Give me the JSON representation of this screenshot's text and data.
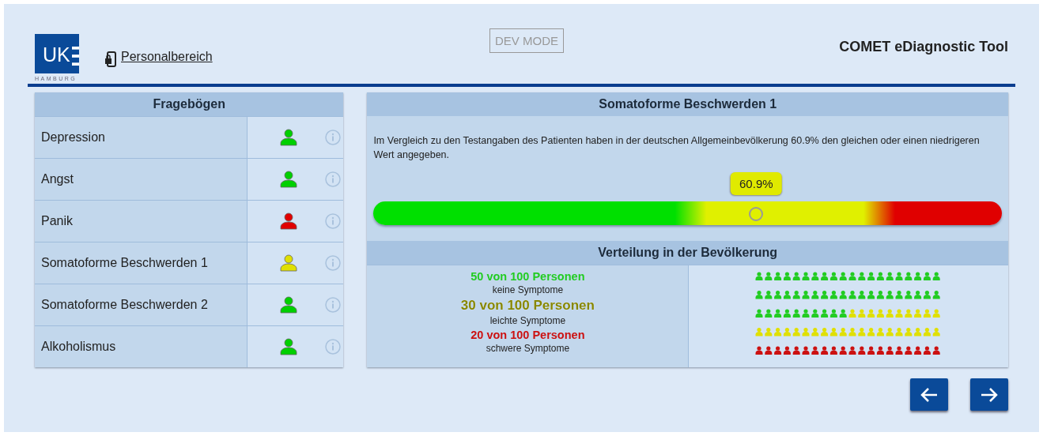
{
  "header": {
    "logo_text": "UK",
    "logo_sub": "HAMBURG",
    "personal_link": "Personalbereich",
    "dev_mode": "DEV MODE",
    "app_title": "COMET eDiagnostic Tool"
  },
  "questionnaires": {
    "title": "Fragebögen",
    "items": [
      {
        "name": "Depression",
        "color": "#00d000"
      },
      {
        "name": "Angst",
        "color": "#00d000"
      },
      {
        "name": "Panik",
        "color": "#e00000"
      },
      {
        "name": "Somatoforme Beschwerden 1",
        "color": "#e0e000"
      },
      {
        "name": "Somatoforme Beschwerden 2",
        "color": "#00d000"
      },
      {
        "name": "Alkoholismus",
        "color": "#00d000"
      }
    ]
  },
  "result": {
    "title": "Somatoforme Beschwerden 1",
    "description": "Im Vergleich zu den Testangaben des Patienten haben in der deutschen Allgemeinbevölkerung 60.9% den gleichen oder einen niedrigeren Wert angegeben.",
    "marker_label": "60.9%",
    "level": 0.609
  },
  "distribution": {
    "title": "Verteilung in der Bevölkerung",
    "groups": [
      {
        "count_label": "50 von 100 Personen",
        "description": "keine Symptome",
        "color": "#22cc22"
      },
      {
        "count_label": "30 von 100 Personen",
        "description": "leichte Symptome",
        "color": "#e0e000"
      },
      {
        "count_label": "20 von 100 Personen",
        "description": "schwere Symptome",
        "color": "#cc1111"
      }
    ]
  }
}
